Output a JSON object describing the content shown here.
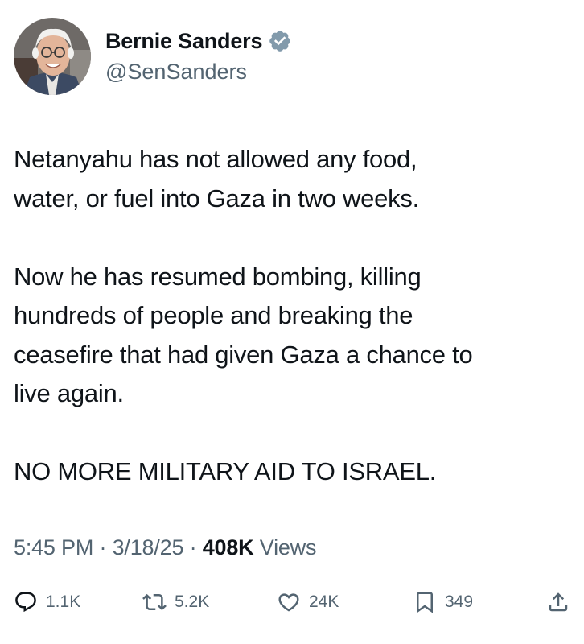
{
  "author": {
    "display_name": "Bernie Sanders",
    "handle": "@SenSanders",
    "avatar_icon": "profile-photo",
    "verified_icon": "verified-badge-icon"
  },
  "tweet": {
    "text": "Netanyahu has not allowed any food,\nwater, or fuel into Gaza in two weeks.\n\nNow he has resumed bombing, killing\nhundreds of people and breaking the\nceasefire that had given Gaza a chance to\nlive again.\n\nNO MORE MILITARY AID TO ISRAEL."
  },
  "meta": {
    "time": "5:45 PM",
    "separator": "·",
    "date": "3/18/25",
    "views_count": "408K",
    "views_label": "Views"
  },
  "actions": {
    "reply": {
      "icon": "reply-icon",
      "count": "1.1K"
    },
    "repost": {
      "icon": "repost-icon",
      "count": "5.2K"
    },
    "like": {
      "icon": "heart-icon",
      "count": "24K"
    },
    "bookmark": {
      "icon": "bookmark-icon",
      "count": "349"
    },
    "share": {
      "icon": "share-icon"
    }
  },
  "colors": {
    "text": "#0f1419",
    "secondary": "#536471",
    "verified_badge": "#829aab"
  }
}
